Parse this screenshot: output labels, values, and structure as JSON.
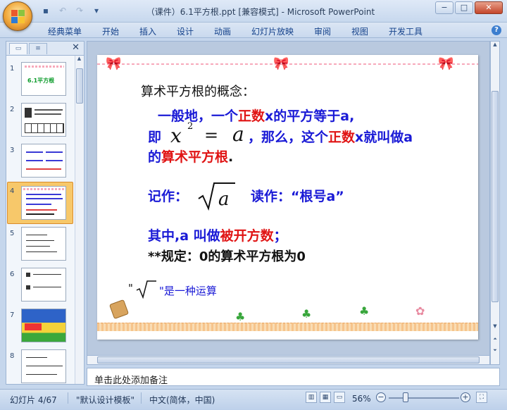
{
  "window": {
    "title": "（课件）6.1平方根.ppt [兼容模式] - Microsoft PowerPoint",
    "minimize": "−",
    "restore": "□",
    "close": "✕"
  },
  "qat": {
    "save": "▪",
    "undo": "↶",
    "redo": "↷",
    "more": "▾"
  },
  "ribbon": {
    "tabs": [
      "经典菜单",
      "开始",
      "插入",
      "设计",
      "动画",
      "幻灯片放映",
      "审阅",
      "视图",
      "开发工具"
    ],
    "help": "?"
  },
  "panel": {
    "close": "✕",
    "slide_numbers": [
      "1",
      "2",
      "3",
      "4",
      "5",
      "6",
      "7",
      "8"
    ],
    "thumb1_text": "6.1平方根",
    "selected_index": 4
  },
  "slide": {
    "heading": "算术平方根的概念：",
    "line1_a": "一般地，一个",
    "line1_red": "正数",
    "line1_b": "x的平方等于a,",
    "line2_prefix": "即",
    "formula_x": "x",
    "formula_exp": "2",
    "formula_eq": "=",
    "formula_a": "a",
    "line2_a": "，那么，这个",
    "line2_red": "正数",
    "line2_b": "x就叫做a",
    "line3_a": "的",
    "line3_red": "算术平方根",
    "line3_b": ".",
    "notation_label": "记作：",
    "sqrt_var": "a",
    "read_label": "读作：“根号a”",
    "radicand_a": "其中,a 叫做",
    "radicand_red": "被开方数",
    "radicand_b": "；",
    "rule": "**规定：0的算术平方根为0",
    "op_quote_open": "\"",
    "op_text": "\"是一种运算"
  },
  "notes": {
    "placeholder": "单击此处添加备注"
  },
  "status": {
    "slide_info": "幻灯片 4/67",
    "theme": "\"默认设计模板\"",
    "language": "中文(简体，中国)",
    "zoom": "56%",
    "zoom_out": "−",
    "zoom_in": "+"
  }
}
